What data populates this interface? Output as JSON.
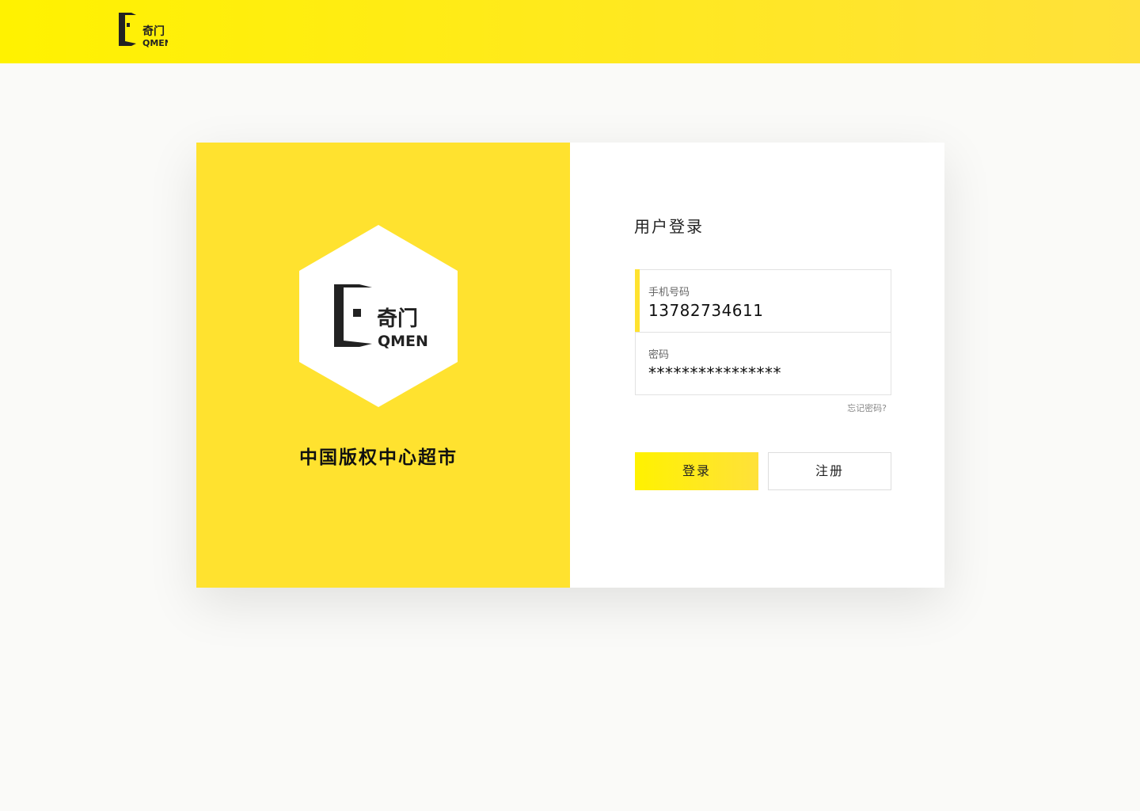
{
  "header": {
    "logo_cn": "奇门",
    "logo_en": "QMEN"
  },
  "brand": {
    "logo_cn": "奇门",
    "logo_en": "QMEN",
    "slogan": "中国版权中心超市"
  },
  "login": {
    "title": "用户登录",
    "phone_label": "手机号码",
    "phone_value": "13782734611",
    "password_label": "密码",
    "password_value": "****************",
    "forgot_link": "忘记密码?",
    "login_button": "登录",
    "register_button": "注册"
  },
  "colors": {
    "accent_yellow": "#ffe22f",
    "bright_yellow": "#fff200",
    "background": "#fafaf8"
  }
}
